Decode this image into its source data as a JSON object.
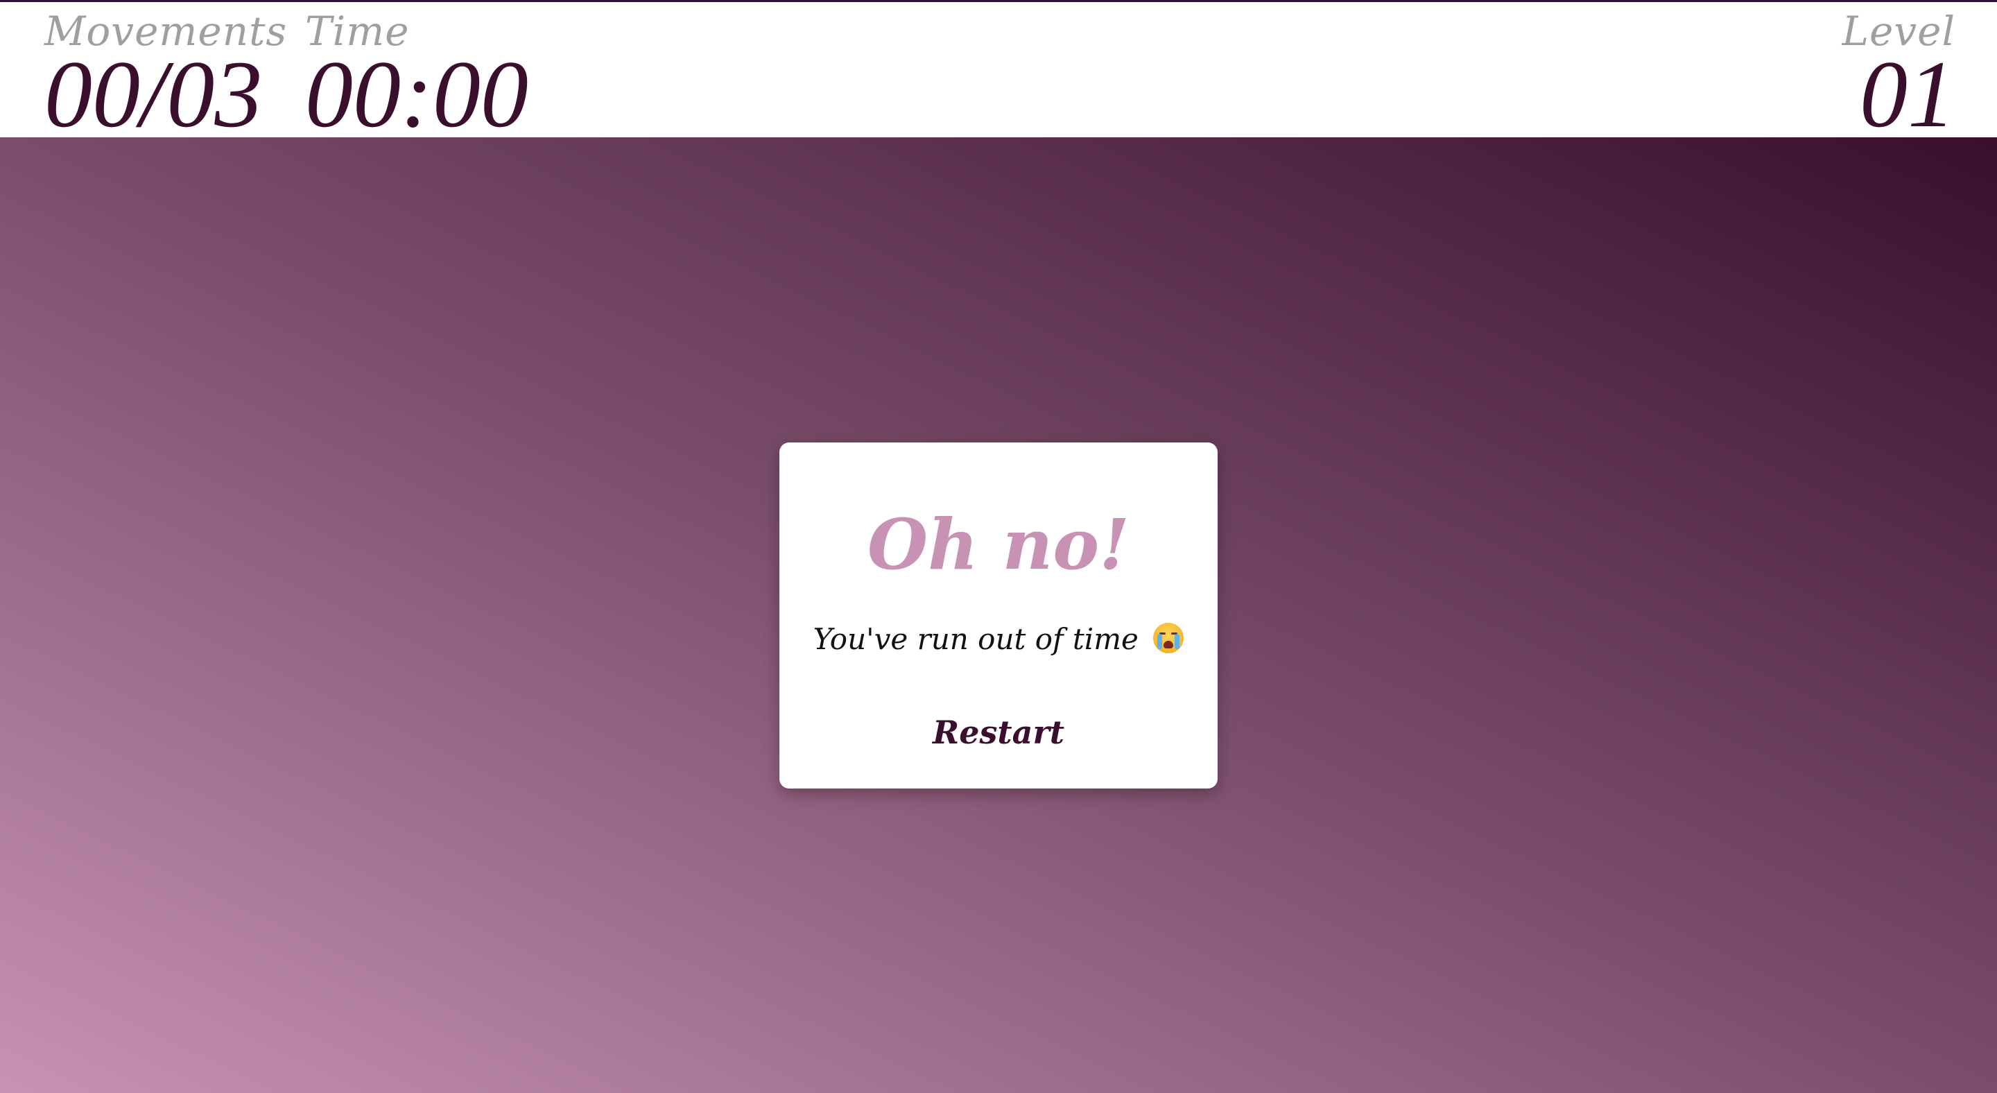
{
  "header": {
    "movements": {
      "label": "Movements",
      "value": "00/03"
    },
    "time": {
      "label": "Time",
      "value": "00:00"
    },
    "level": {
      "label": "Level",
      "value": "01"
    }
  },
  "modal": {
    "title": "Oh no!",
    "message": "You've run out of time",
    "message_icon": "loudly-crying-face-emoji",
    "restart_label": "Restart"
  },
  "colors": {
    "accent": "#c792b4",
    "dark": "#3a0f2e",
    "label_gray": "#a09ea3",
    "gradient_light": "#c792b4",
    "gradient_dark": "#3a0f2e"
  }
}
